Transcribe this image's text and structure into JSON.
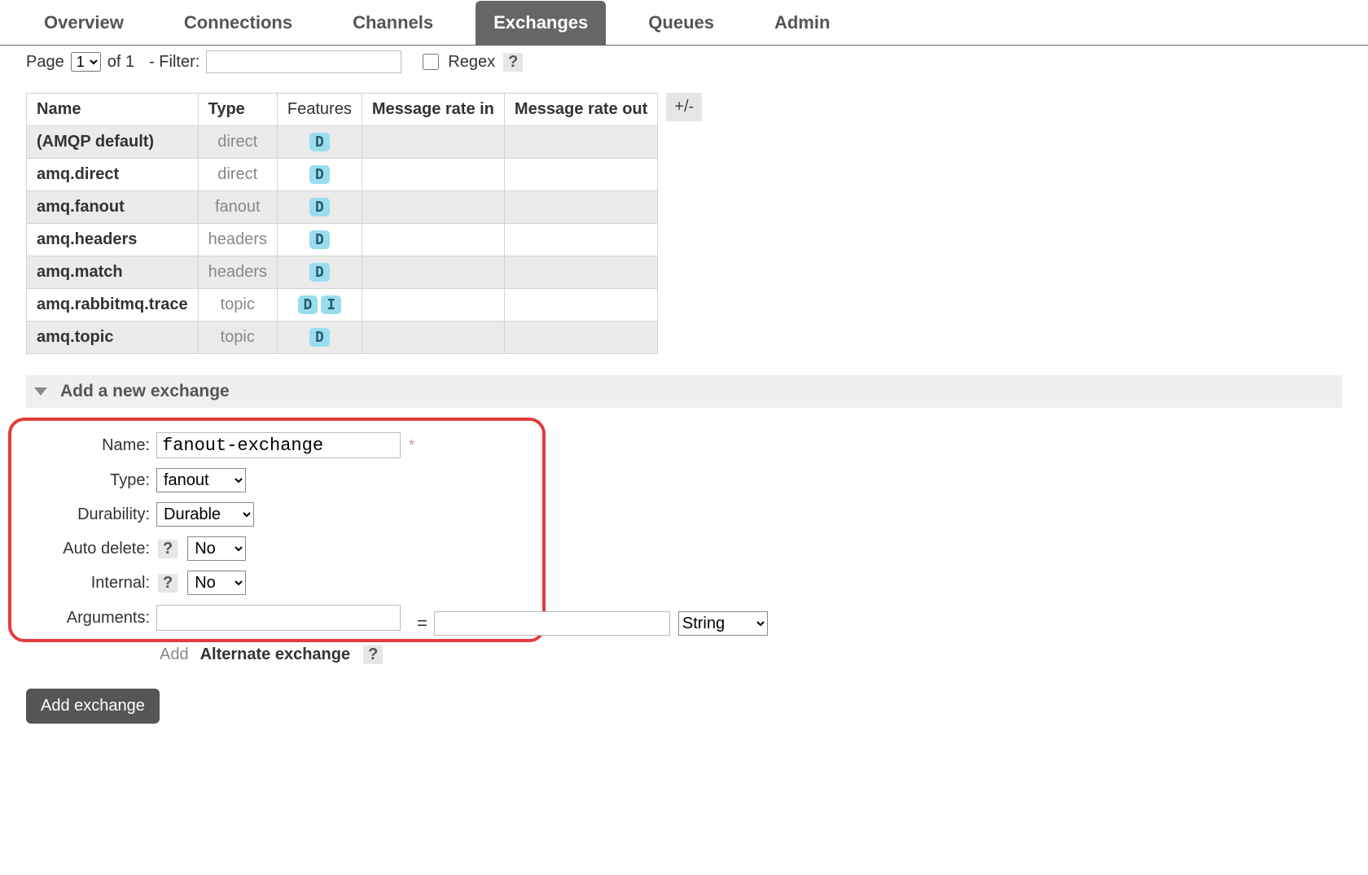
{
  "tabs": [
    "Overview",
    "Connections",
    "Channels",
    "Exchanges",
    "Queues",
    "Admin"
  ],
  "active_tab": "Exchanges",
  "pager": {
    "page_label": "Page",
    "page_value": "1",
    "of_label": "of 1",
    "filter_label": "- Filter:",
    "filter_value": "",
    "regex_label": "Regex",
    "regex_help": "?"
  },
  "table": {
    "headers": {
      "name": "Name",
      "type": "Type",
      "features": "Features",
      "rate_in": "Message rate in",
      "rate_out": "Message rate out"
    },
    "plusminus": "+/-",
    "rows": [
      {
        "name": "(AMQP default)",
        "type": "direct",
        "features": [
          "D"
        ],
        "rate_in": "",
        "rate_out": ""
      },
      {
        "name": "amq.direct",
        "type": "direct",
        "features": [
          "D"
        ],
        "rate_in": "",
        "rate_out": ""
      },
      {
        "name": "amq.fanout",
        "type": "fanout",
        "features": [
          "D"
        ],
        "rate_in": "",
        "rate_out": ""
      },
      {
        "name": "amq.headers",
        "type": "headers",
        "features": [
          "D"
        ],
        "rate_in": "",
        "rate_out": ""
      },
      {
        "name": "amq.match",
        "type": "headers",
        "features": [
          "D"
        ],
        "rate_in": "",
        "rate_out": ""
      },
      {
        "name": "amq.rabbitmq.trace",
        "type": "topic",
        "features": [
          "D",
          "I"
        ],
        "rate_in": "",
        "rate_out": ""
      },
      {
        "name": "amq.topic",
        "type": "topic",
        "features": [
          "D"
        ],
        "rate_in": "",
        "rate_out": ""
      }
    ]
  },
  "section": {
    "title": "Add a new exchange"
  },
  "form": {
    "name_label": "Name:",
    "name_value": "fanout-exchange",
    "type_label": "Type:",
    "type_value": "fanout",
    "durability_label": "Durability:",
    "durability_value": "Durable",
    "autodelete_label": "Auto delete:",
    "autodelete_value": "No",
    "autodelete_help": "?",
    "internal_label": "Internal:",
    "internal_value": "No",
    "internal_help": "?",
    "arguments_label": "Arguments:",
    "arg_key": "",
    "arg_val": "",
    "arg_eq": "=",
    "arg_type": "String",
    "add_hint": {
      "add": "Add",
      "alternate": "Alternate exchange",
      "help": "?"
    },
    "submit": "Add exchange",
    "required": "*"
  }
}
